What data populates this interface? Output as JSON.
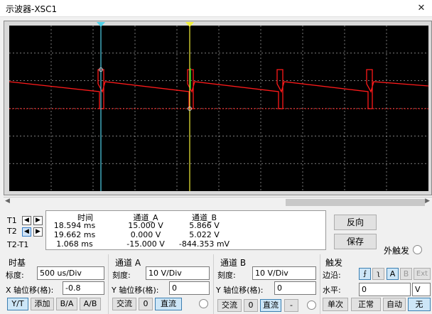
{
  "window": {
    "title": "示波器-XSC1",
    "close_glyph": "✕"
  },
  "colors": {
    "trace_a": "#ff1a1a",
    "cursor_t1": "#4fd0e8",
    "cursor_t2": "#f2f03a",
    "screen_bg": "#000000",
    "grid": "#c8c8c8"
  },
  "readout": {
    "headers": [
      "时间",
      "通道_A",
      "通道_B"
    ],
    "rows": [
      {
        "label": "T1",
        "time": "18.594 ms",
        "a": "15.000 V",
        "b": "5.866 V"
      },
      {
        "label": "T2",
        "time": "19.662 ms",
        "a": "0.000 V",
        "b": "5.022 V"
      },
      {
        "label": "T2-T1",
        "time": "1.068 ms",
        "a": "-15.000 V",
        "b": "-844.353 mV"
      }
    ]
  },
  "buttons": {
    "reverse": "反向",
    "save": "保存",
    "external_trigger": "外触发"
  },
  "timebase": {
    "title": "时基",
    "scale_label": "标度:",
    "scale_value": "500 us/Div",
    "xpos_label": "X 轴位移(格):",
    "xpos_value": "-0.8",
    "mode_buttons": [
      "Y/T",
      "添加",
      "B/A",
      "A/B"
    ],
    "active_mode": "Y/T"
  },
  "channel_a": {
    "title": "通道 A",
    "scale_label": "刻度:",
    "scale_value": "10  V/Div",
    "ypos_label": "Y 轴位移(格):",
    "ypos_value": "0",
    "coupling": [
      "交流",
      "0",
      "直流"
    ],
    "active_coupling": "直流"
  },
  "channel_b": {
    "title": "通道 B",
    "scale_label": "刻度:",
    "scale_value": "10  V/Div",
    "ypos_label": "Y 轴位移(格):",
    "ypos_value": "0",
    "coupling": [
      "交流",
      "0",
      "直流",
      "-"
    ],
    "active_coupling": "直流"
  },
  "trigger": {
    "title": "触发",
    "edge_label": "边沿:",
    "edge_buttons": [
      "⨍",
      "ʅ",
      "A",
      "B",
      "Ext"
    ],
    "active_source": "A",
    "level_label": "水平:",
    "level_value": "0",
    "level_unit": "V",
    "mode_buttons": [
      "单次",
      "正常",
      "自动",
      "无"
    ],
    "active_mode": "无"
  },
  "cursor_labels": {
    "t1": "T1",
    "t2": "T2",
    "diff": "T2-T1"
  },
  "arrows": {
    "left": "◀",
    "right": "▶"
  }
}
